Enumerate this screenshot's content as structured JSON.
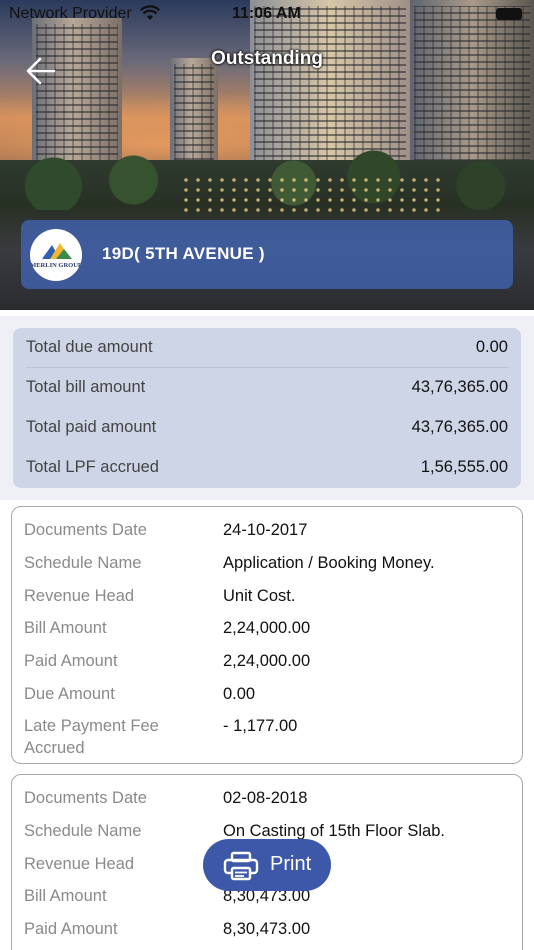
{
  "status_bar": {
    "carrier": "Network Provider",
    "time": "11:06 AM"
  },
  "nav": {
    "title": "Outstanding"
  },
  "project": {
    "name": "19D( 5TH AVENUE )",
    "logo_text": "MERLIN GROUP"
  },
  "summary": [
    {
      "label": "Total due amount",
      "value": "0.00"
    },
    {
      "label": "Total bill amount",
      "value": "43,76,365.00"
    },
    {
      "label": "Total paid amount",
      "value": "43,76,365.00"
    },
    {
      "label": "Total LPF accrued",
      "value": "1,56,555.00"
    }
  ],
  "records": [
    {
      "documents_date_label": "Documents Date",
      "documents_date": "24-10-2017",
      "schedule_name_label": "Schedule Name",
      "schedule_name": "Application / Booking Money.",
      "revenue_head_label": "Revenue Head",
      "revenue_head": "Unit Cost.",
      "bill_amount_label": "Bill Amount",
      "bill_amount": "2,24,000.00",
      "paid_amount_label": "Paid Amount",
      "paid_amount": "2,24,000.00",
      "due_amount_label": "Due Amount",
      "due_amount": "0.00",
      "lpf_label_line1": "Late Payment Fee",
      "lpf_label_line2": "Accrued",
      "lpf": "- 1,177.00"
    },
    {
      "documents_date_label": "Documents Date",
      "documents_date": "02-08-2018",
      "schedule_name_label": "Schedule Name",
      "schedule_name": "On Casting of 15th Floor Slab.",
      "revenue_head_label": "Revenue Head",
      "revenue_head": "",
      "bill_amount_label": "Bill Amount",
      "bill_amount": "8,30,473.00",
      "paid_amount_label": "Paid Amount",
      "paid_amount": "8,30,473.00"
    }
  ],
  "print_button": {
    "label": "Print"
  },
  "icons": {
    "back": "arrow-left-icon",
    "wifi": "wifi-icon",
    "battery": "battery-icon",
    "print": "printer-icon",
    "logo": "merlin-logo"
  },
  "colors": {
    "accent": "#3d58a8",
    "summary_bg": "#ced5e6",
    "project_card": "#4268be"
  }
}
